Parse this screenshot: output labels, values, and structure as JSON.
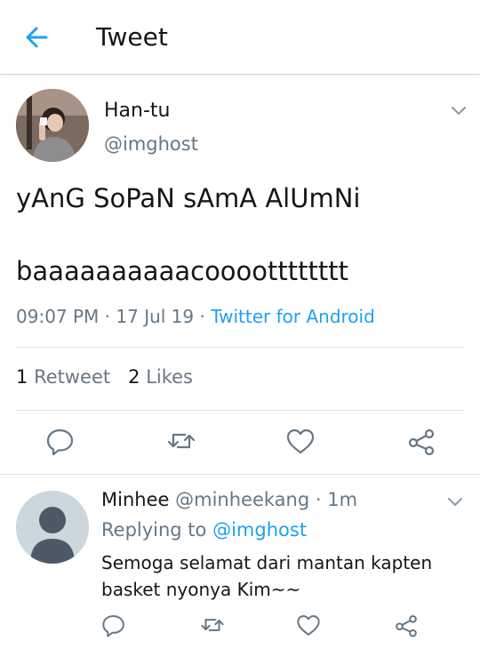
{
  "header": {
    "title": "Tweet"
  },
  "tweet": {
    "author_name": "Han-tu",
    "author_handle": "@imghost",
    "text_line1": "yAnG SoPaN sAmA AlUmNi",
    "text_line2": "baaaaaaaaaacooootttttttt",
    "time": "09:07 PM",
    "date": "17 Jul 19",
    "sep": "·",
    "source": "Twitter for Android",
    "retweets": "1",
    "retweets_label": "Retweet",
    "likes": "2",
    "likes_label": "Likes"
  },
  "reply": {
    "name": "Minhee",
    "handle": "@minheekang",
    "dot": "·",
    "time": "1m",
    "replying_prefix": "Replying to",
    "replying_to": "@imghost",
    "text": "Semoga selamat dari mantan kapten basket nyonya Kim~~"
  },
  "colors": {
    "accent": "#1da1f2",
    "secondary_text": "#657786",
    "icon": "#657786",
    "divider": "#dfe3e6"
  },
  "icons": {
    "back": "arrow-left-icon",
    "caret": "chevron-down-icon",
    "reply": "comment-bubble-icon",
    "retweet": "retweet-icon",
    "like": "heart-icon",
    "share": "share-icon"
  }
}
